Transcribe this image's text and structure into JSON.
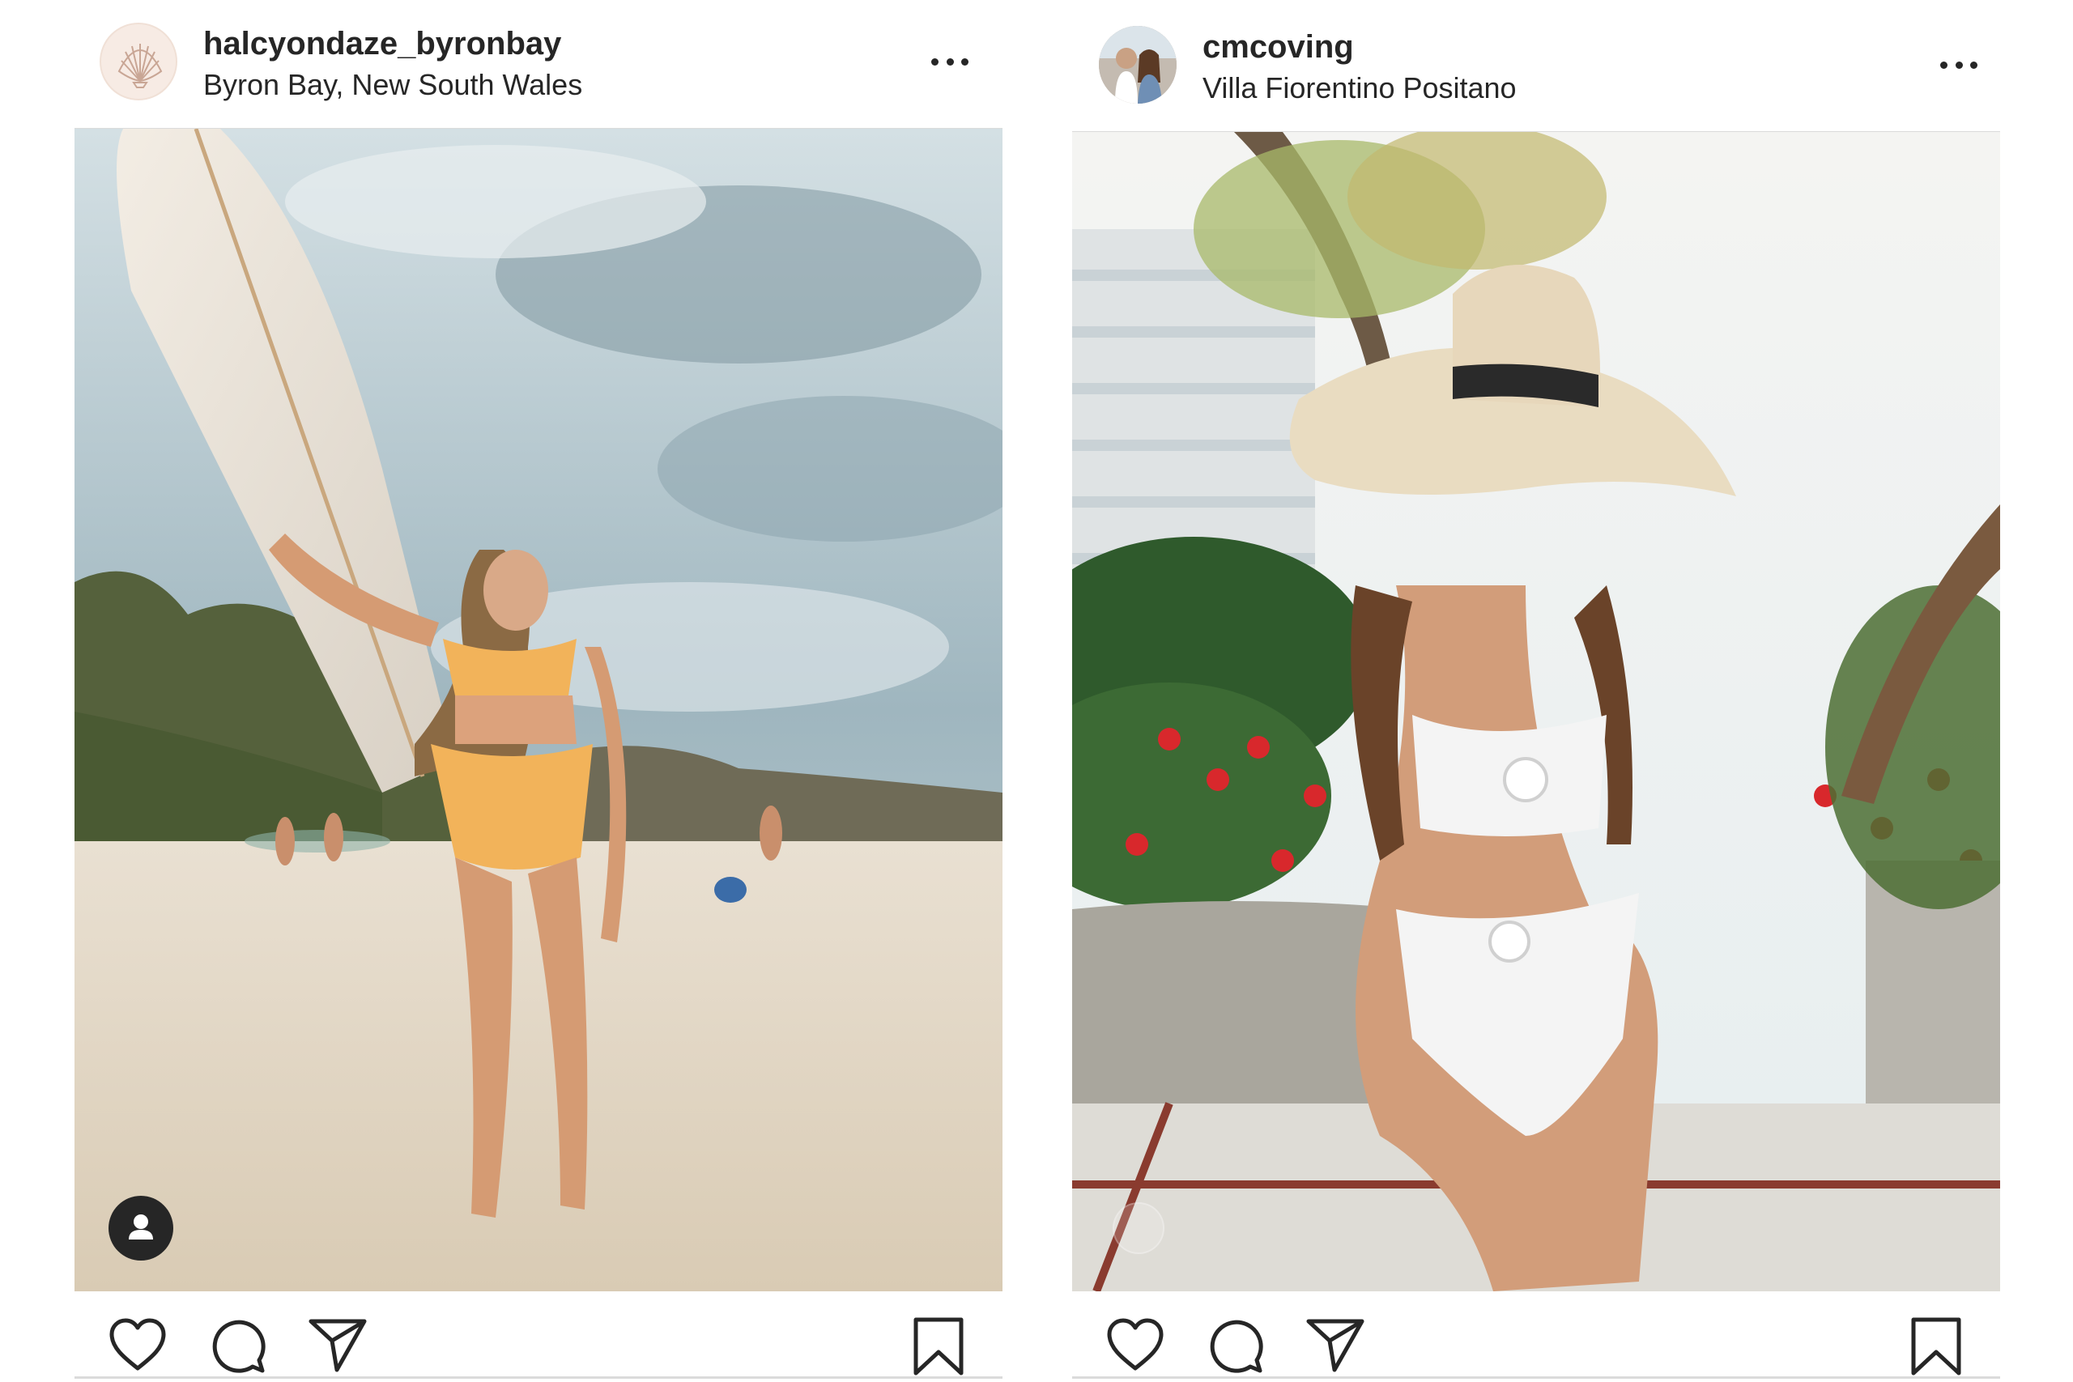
{
  "posts": [
    {
      "username": "halcyondaze_byronbay",
      "location": "Byron Bay, New South Wales",
      "avatar_icon": "scallop-shell-icon",
      "photo_description_icon": "user-tag-icon"
    },
    {
      "username": "cmcoving",
      "location": "Villa Fiorentino Positano",
      "avatar_icon": "profile-photo"
    }
  ],
  "icons": {
    "more": "more-options-icon",
    "like": "heart-icon",
    "comment": "comment-icon",
    "share": "send-icon",
    "save": "bookmark-icon"
  },
  "colors": {
    "text": "#262626",
    "divider": "#dbdbdb",
    "avatar_bg_left": "#f7ebe4"
  }
}
